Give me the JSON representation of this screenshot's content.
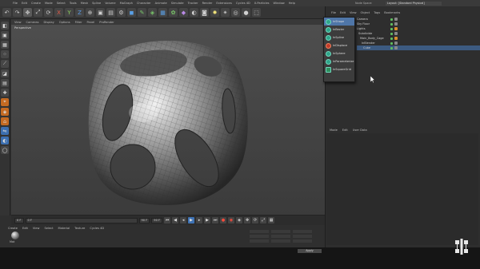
{
  "menubar": [
    "File",
    "Edit",
    "Create",
    "Mode",
    "Select",
    "Tools",
    "Mesh",
    "Spline",
    "Volume",
    "MoGraph",
    "Character",
    "Animate",
    "Simulate",
    "Tracker",
    "Render",
    "Extensions",
    "Cycles 4D",
    "X-Particles",
    "Window",
    "Help"
  ],
  "layout": {
    "label": "Node Space:",
    "value": "Layout: [Standard Physical]"
  },
  "viewport": {
    "menu": [
      "View",
      "Cameras",
      "Display",
      "Options",
      "Filter",
      "Panel",
      "ProRender"
    ],
    "label": "Perspective"
  },
  "object_manager": {
    "tabs": [
      "File",
      "Edit",
      "View",
      "Object",
      "Tags",
      "Bookmarks"
    ],
    "objects": [
      {
        "name": "Camera",
        "selected": false
      },
      {
        "name": "Sky Floor",
        "selected": false
      },
      {
        "name": "Lights",
        "selected": false
      },
      {
        "name": "Subdivide",
        "selected": false
      },
      {
        "name": "Main_Body_Cage",
        "selected": false
      },
      {
        "name": "InBlender",
        "selected": false
      },
      {
        "name": "Cube",
        "selected": true
      }
    ]
  },
  "dropdown": {
    "items": [
      {
        "label": "InShape",
        "icon": "bevel-icon",
        "highlighted": true
      },
      {
        "label": "InBezier",
        "icon": "bezier-icon",
        "highlighted": false
      },
      {
        "label": "InSpline",
        "icon": "spline-icon",
        "highlighted": false
      },
      {
        "label": "InDisplace",
        "icon": "displace-icon",
        "highlighted": false
      },
      {
        "label": "InSphere",
        "icon": "sphere-icon",
        "highlighted": false
      },
      {
        "label": "InParameterize",
        "icon": "parameterize-icon",
        "highlighted": false
      },
      {
        "label": "InSquareGrid",
        "icon": "grid-icon",
        "highlighted": false
      }
    ]
  },
  "attributes": {
    "tabs": [
      "Mode",
      "Edit",
      "User Data"
    ]
  },
  "timeline": {
    "start_frame": "0 F",
    "end_frame": "90 F",
    "max_frame": "90 F",
    "current": "0 F"
  },
  "materials": {
    "menu": [
      "Create",
      "Edit",
      "View",
      "Select",
      "Material",
      "Texture",
      "Cycles 4D"
    ],
    "name": "Mat"
  },
  "coords": {
    "apply": "Apply"
  },
  "colors": {
    "accent": "#4f76a8",
    "play": "#3f73b5",
    "record": "#ff4a3a"
  }
}
